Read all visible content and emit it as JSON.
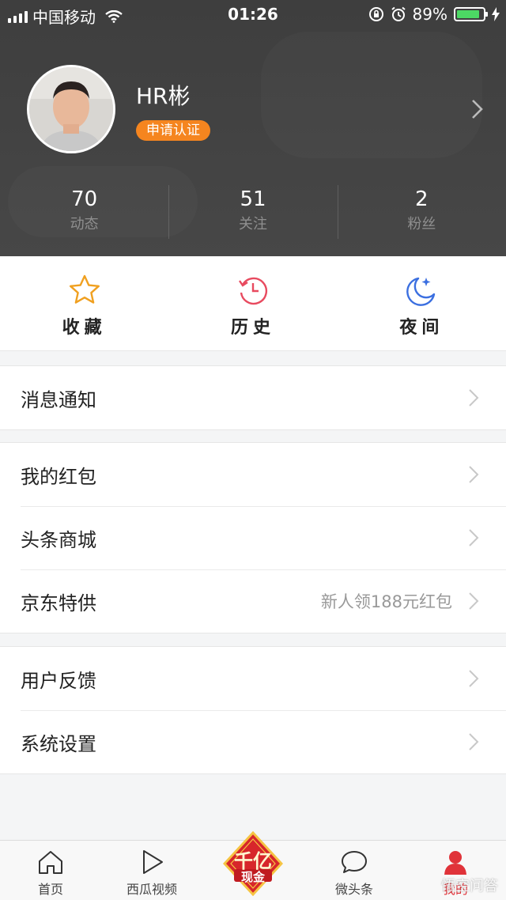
{
  "status_bar": {
    "carrier": "中国移动",
    "time": "01:26",
    "battery_percent": "89%",
    "battery_level": 0.89,
    "icons": [
      "signal-icon",
      "wifi-icon",
      "orientation-lock-icon",
      "alarm-icon",
      "battery-icon",
      "charging-icon"
    ]
  },
  "profile": {
    "username": "HR彬",
    "verify_label": "申请认证",
    "stats": [
      {
        "value": "70",
        "label": "动态"
      },
      {
        "value": "51",
        "label": "关注"
      },
      {
        "value": "2",
        "label": "粉丝"
      }
    ]
  },
  "quick_actions": [
    {
      "label": "收藏",
      "icon": "star-icon",
      "color": "#f0a020"
    },
    {
      "label": "历史",
      "icon": "history-clock-icon",
      "color": "#e84a5f"
    },
    {
      "label": "夜间",
      "icon": "moon-icon",
      "color": "#3b6fe0"
    }
  ],
  "menu": {
    "group1": [
      {
        "label": "消息通知"
      }
    ],
    "group2": [
      {
        "label": "我的红包"
      },
      {
        "label": "头条商城"
      },
      {
        "label": "京东特供",
        "sub": "新人领188元红包"
      }
    ],
    "group3": [
      {
        "label": "用户反馈"
      },
      {
        "label": "系统设置"
      }
    ]
  },
  "tabbar": {
    "tabs": [
      {
        "label": "首页",
        "icon": "home-icon"
      },
      {
        "label": "西瓜视频",
        "icon": "play-icon"
      },
      {
        "label": "",
        "icon": "promo-badge-icon"
      },
      {
        "label": "微头条",
        "icon": "chat-bubble-icon"
      },
      {
        "label": "我的",
        "icon": "person-icon"
      }
    ],
    "promo_line1": "千亿",
    "promo_line2": "现金",
    "active_index": 4
  },
  "watermark": "悟空问答",
  "colors": {
    "accent": "#f5851f",
    "active_tab": "#e0333a",
    "header_bg": "#424242"
  }
}
